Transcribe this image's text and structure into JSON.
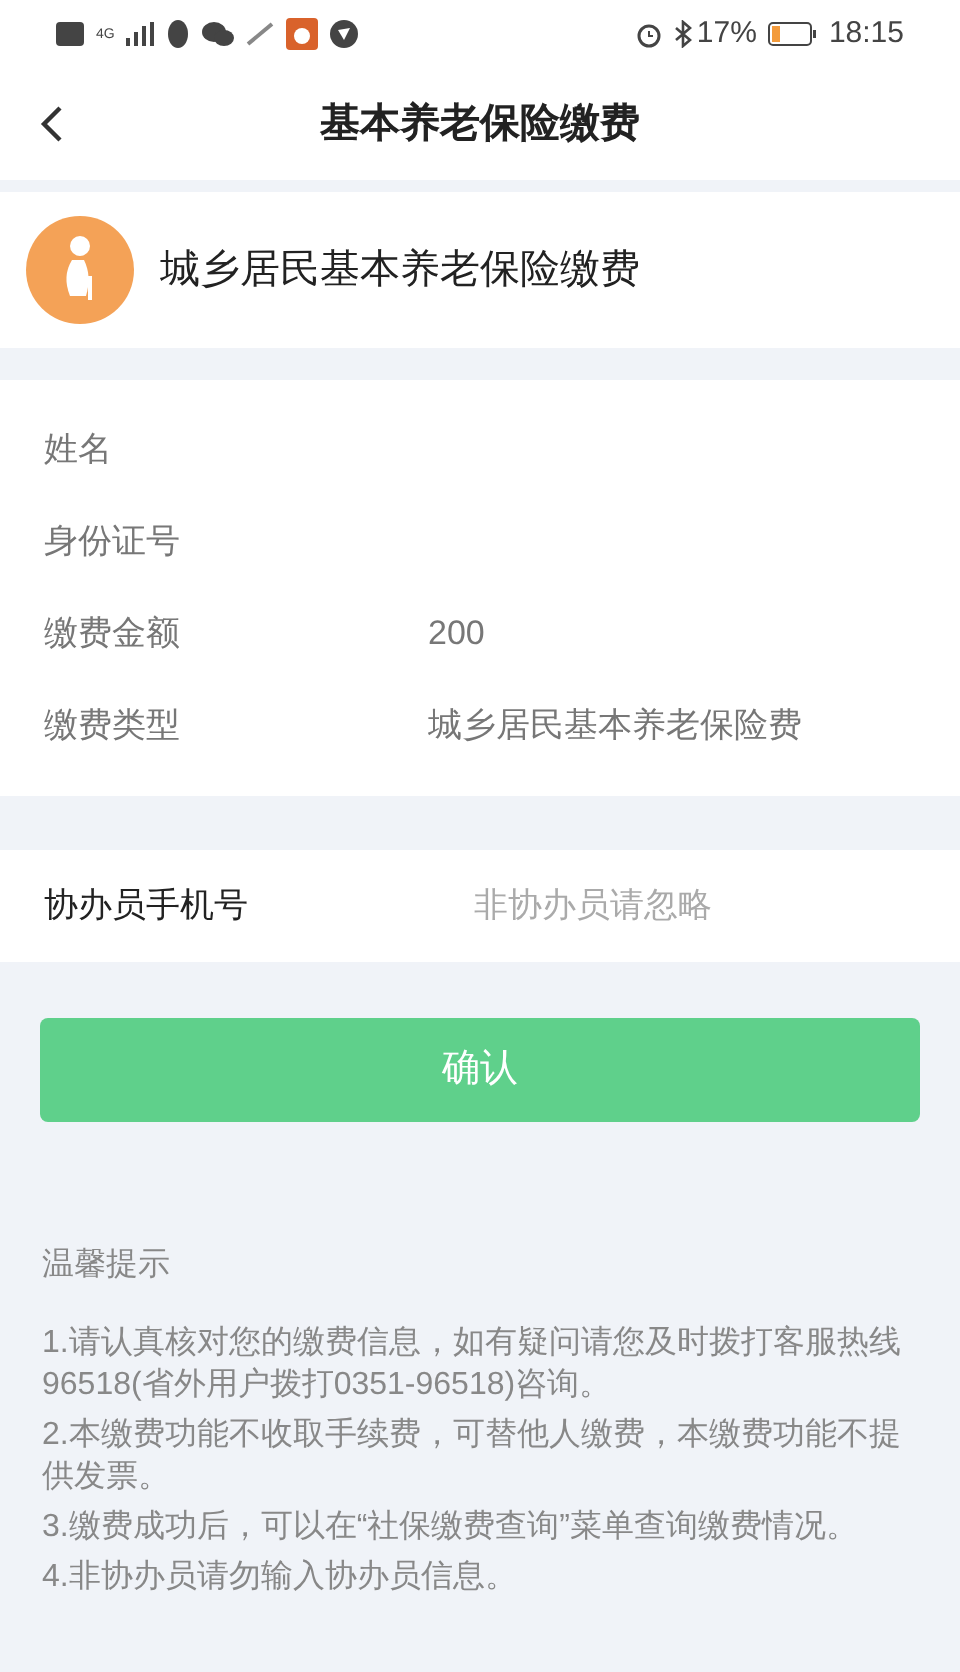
{
  "status_bar": {
    "network": "4G",
    "battery": "17%",
    "time": "18:15"
  },
  "header": {
    "title": "基本养老保险缴费"
  },
  "service": {
    "name": "城乡居民基本养老保险缴费"
  },
  "fields": [
    {
      "label": "姓名"
    },
    {
      "label": "身份证号"
    },
    {
      "label": "缴费金额",
      "value": "200"
    },
    {
      "label": "缴费类型",
      "value": "城乡居民基本养老保险费"
    }
  ],
  "assistant": {
    "label": "协办员手机号",
    "placeholder": "非协办员请忽略"
  },
  "confirm_button": "确认",
  "tips": {
    "title": "温馨提示",
    "items": [
      "1.请认真核对您的缴费信息，如有疑问请您及时拨打客服热线96518(省外用户拨打0351-96518)咨询。",
      "2.本缴费功能不收取手续费，可替他人缴费，本缴费功能不提供发票。",
      "3.缴费成功后，可以在“社保缴费查询”菜单查询缴费情况。",
      "4.非协办员请勿输入协办员信息。"
    ]
  }
}
